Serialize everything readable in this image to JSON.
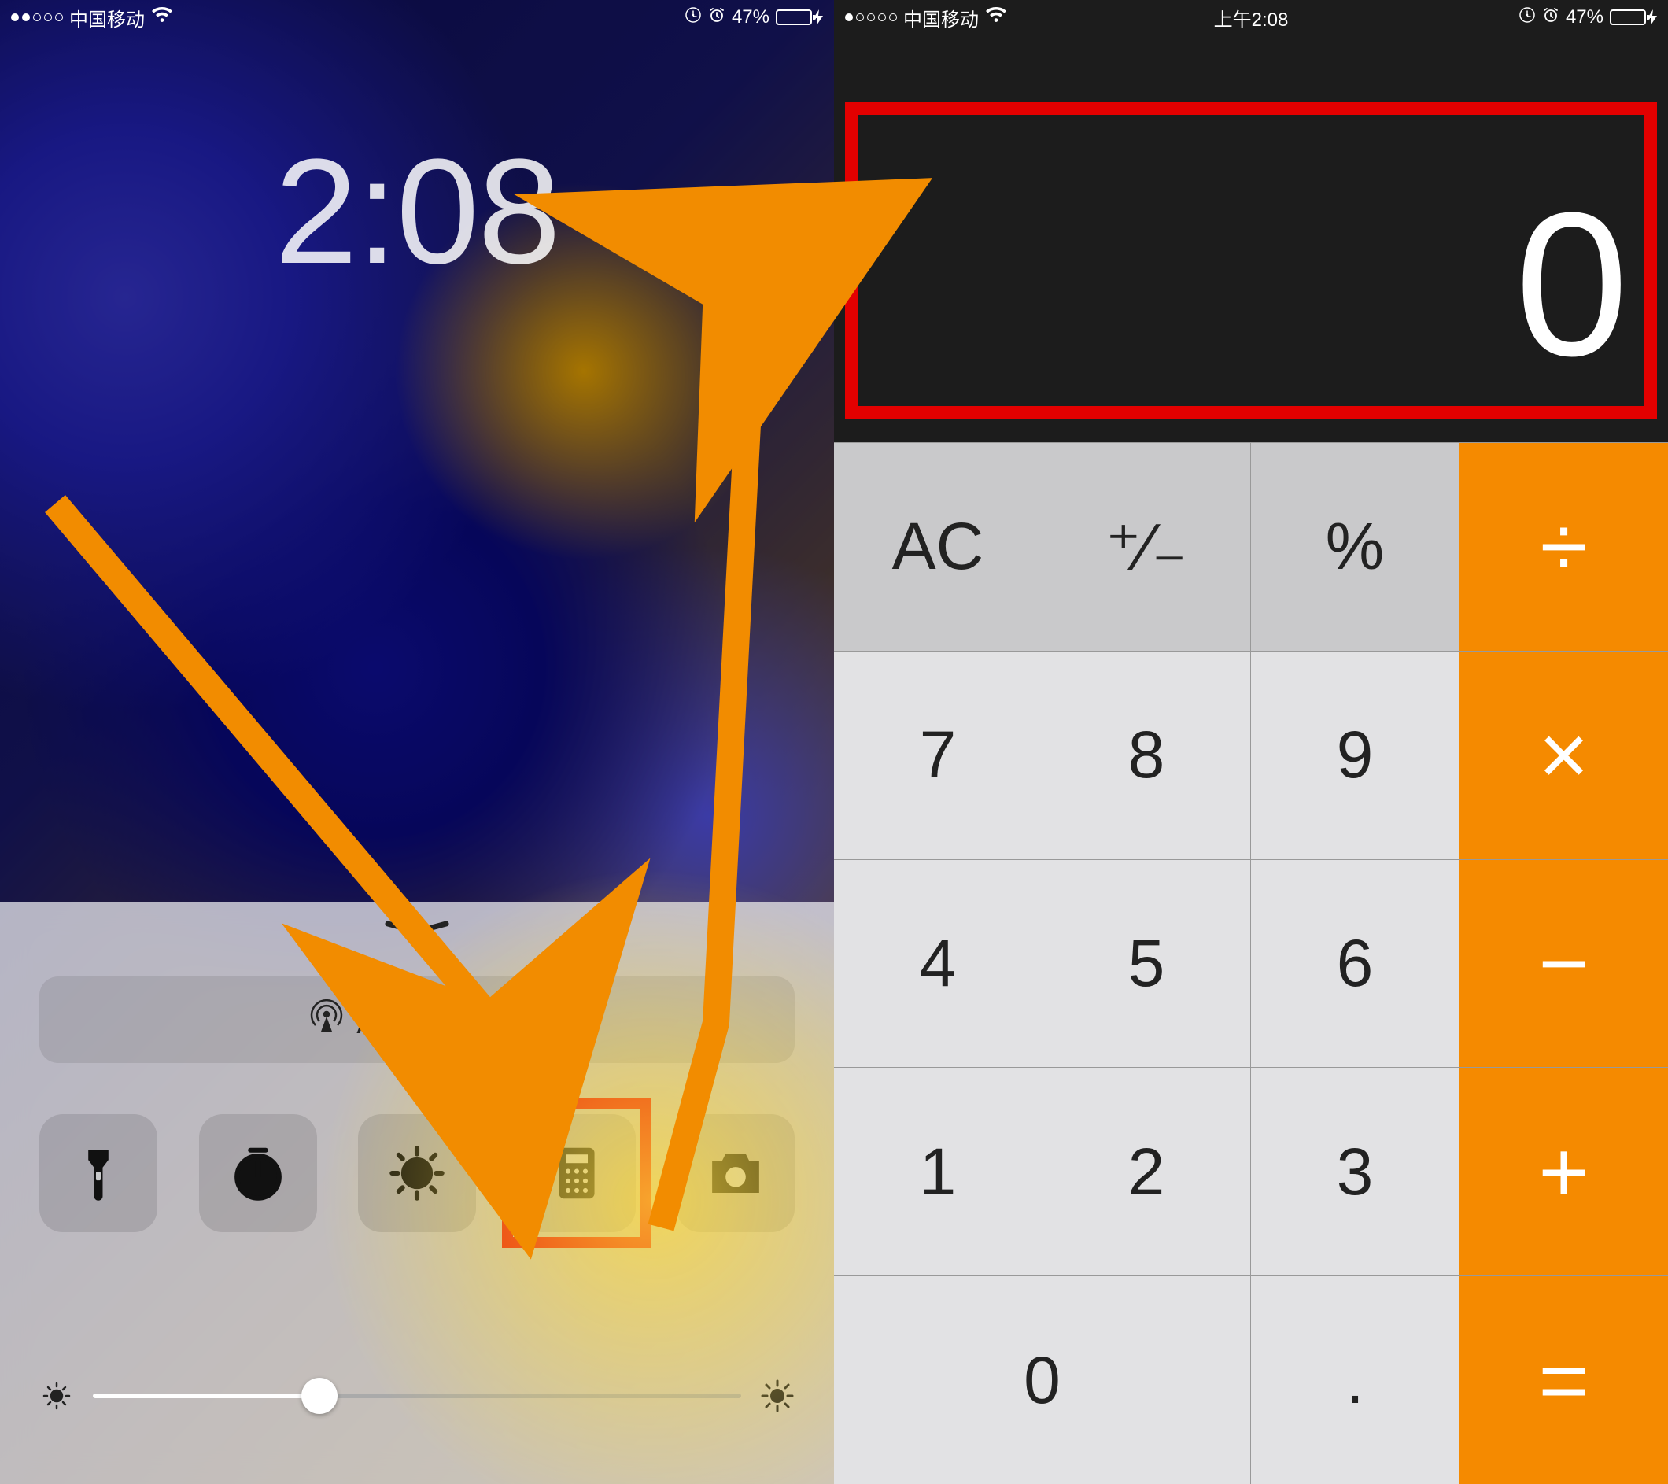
{
  "left": {
    "status": {
      "signal_filled": 2,
      "signal_total": 5,
      "carrier": "中国移动",
      "battery_pct": "47%",
      "battery_fill": 47
    },
    "lock_time": "2:08",
    "control_center": {
      "airdrop_label": "AirDrop 共享",
      "shortcuts": [
        "flashlight",
        "timer",
        "nightshift",
        "calculator",
        "camera"
      ],
      "brightness_pct": 35
    }
  },
  "right": {
    "status": {
      "signal_filled": 1,
      "signal_total": 5,
      "carrier": "中国移动",
      "clock": "上午2:08",
      "battery_pct": "47%",
      "battery_fill": 47
    },
    "display": "0",
    "keys": {
      "ac": "AC",
      "sign": "⁺∕₋",
      "pct": "%",
      "div": "÷",
      "k7": "7",
      "k8": "8",
      "k9": "9",
      "mul": "×",
      "k4": "4",
      "k5": "5",
      "k6": "6",
      "sub": "−",
      "k1": "1",
      "k2": "2",
      "k3": "3",
      "add": "+",
      "k0": "0",
      "dot": ".",
      "eq": "="
    }
  },
  "annotation": {
    "highlight_calc_shortcut": true,
    "highlight_display": true
  }
}
